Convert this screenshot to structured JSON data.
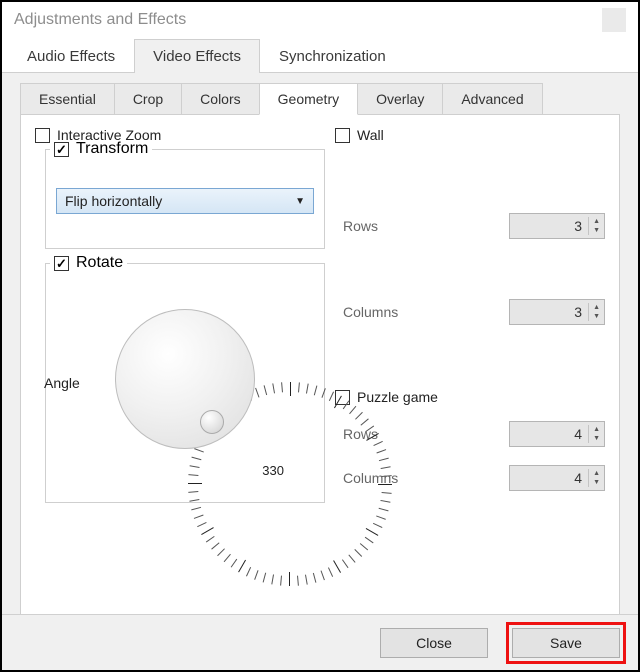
{
  "title": "Adjustments and Effects",
  "top_tabs": {
    "audio": "Audio Effects",
    "video": "Video Effects",
    "sync": "Synchronization",
    "active": "video"
  },
  "sub_tabs": {
    "essential": "Essential",
    "crop": "Crop",
    "colors": "Colors",
    "geometry": "Geometry",
    "overlay": "Overlay",
    "advanced": "Advanced",
    "active": "geometry"
  },
  "geometry": {
    "interactive_zoom": {
      "label": "Interactive Zoom",
      "checked": false
    },
    "transform": {
      "label": "Transform",
      "checked": true,
      "selection": "Flip horizontally"
    },
    "rotate": {
      "label": "Rotate",
      "checked": true,
      "angle_label": "Angle",
      "tick_label": "330"
    },
    "wall": {
      "label": "Wall",
      "checked": false,
      "rows_label": "Rows",
      "rows": "3",
      "cols_label": "Columns",
      "cols": "3"
    },
    "puzzle": {
      "label": "Puzzle game",
      "checked": false,
      "rows_label": "Rows",
      "rows": "4",
      "cols_label": "Columns",
      "cols": "4"
    }
  },
  "buttons": {
    "close": "Close",
    "save": "Save"
  }
}
